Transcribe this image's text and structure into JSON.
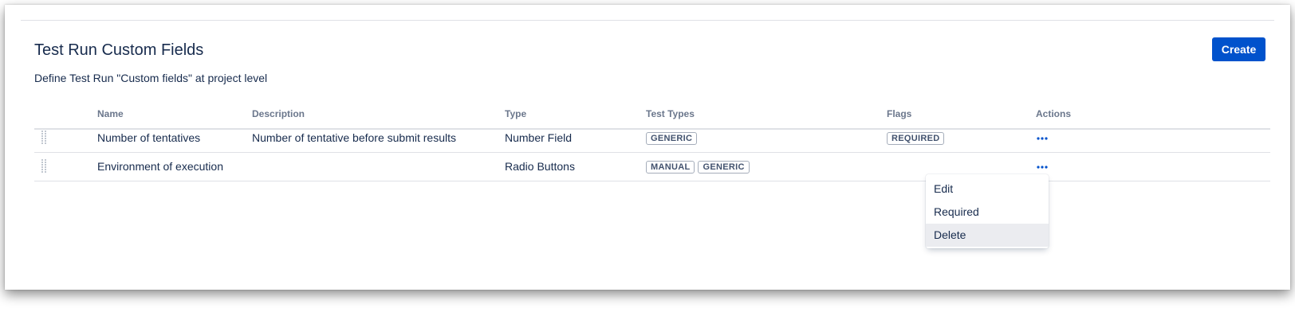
{
  "page": {
    "title": "Test Run Custom Fields",
    "description": "Define Test Run \"Custom fields\" at project level",
    "create_label": "Create"
  },
  "colors": {
    "primary": "#0052cc",
    "text": "#172b4d",
    "muted": "#6b778c",
    "border": "#dfe1e6",
    "menu_active_bg": "#ebecf0"
  },
  "table": {
    "headers": {
      "name": "Name",
      "description": "Description",
      "type": "Type",
      "test_types": "Test Types",
      "flags": "Flags",
      "actions": "Actions"
    },
    "rows": [
      {
        "name": "Number of tentatives",
        "description": "Number of tentative before submit results",
        "type": "Number Field",
        "test_types": [
          "GENERIC"
        ],
        "flags": [
          "REQUIRED"
        ],
        "actions_icon": "more-horizontal-icon"
      },
      {
        "name": "Environment of execution",
        "description": "",
        "type": "Radio Buttons",
        "test_types": [
          "MANUAL",
          "GENERIC"
        ],
        "flags": [],
        "actions_icon": "more-horizontal-icon"
      }
    ]
  },
  "actions_menu": {
    "items": [
      "Edit",
      "Required",
      "Delete"
    ],
    "highlighted": "Delete"
  },
  "icons": {
    "drag": "drag-handle-icon",
    "more": "more-horizontal-icon"
  }
}
